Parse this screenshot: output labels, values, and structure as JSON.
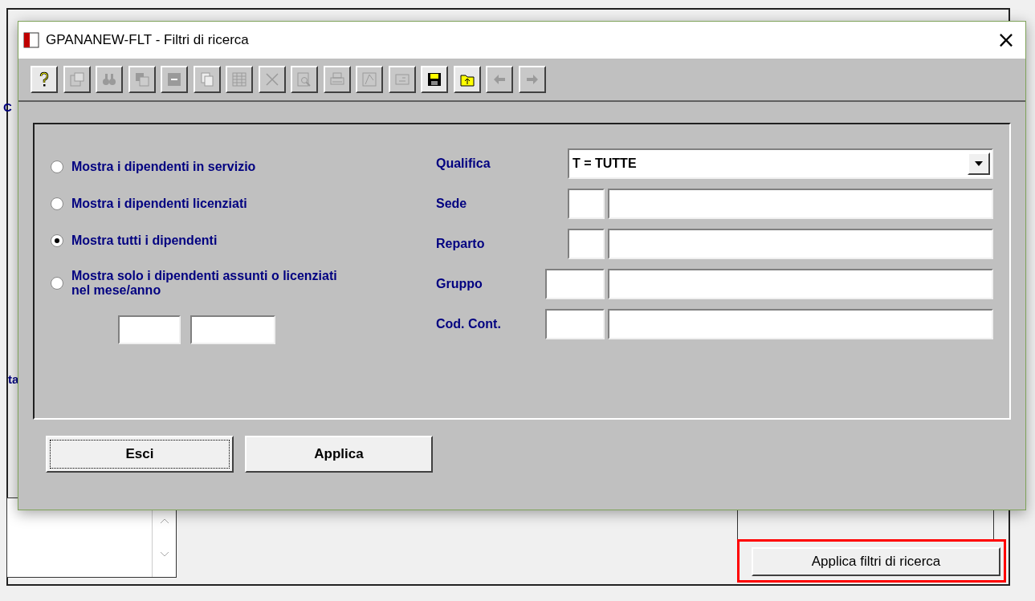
{
  "background": {
    "fragments": [
      "C",
      "ta"
    ],
    "apply_button": "Applica filtri di ricerca",
    "highlighted": true
  },
  "window": {
    "title": "GPANANEW-FLT - Filtri di ricerca",
    "close": "×"
  },
  "toolbar": [
    {
      "disabled": false
    },
    {
      "disabled": true
    },
    {
      "disabled": true
    },
    {
      "disabled": true
    },
    {
      "disabled": true
    },
    {
      "disabled": true
    },
    {
      "disabled": true
    },
    {
      "disabled": true
    },
    {
      "disabled": true
    },
    {
      "disabled": true
    },
    {
      "disabled": true
    },
    {
      "disabled": true
    },
    {
      "disabled": false
    },
    {
      "disabled": false
    },
    {
      "disabled": true
    },
    {
      "disabled": true
    }
  ],
  "options": [
    {
      "label": "Mostra i dipendenti in servizio",
      "selected": false
    },
    {
      "label": "Mostra i dipendenti licenziati",
      "selected": false
    },
    {
      "label": "Mostra tutti i dipendenti",
      "selected": true
    },
    {
      "label": "Mostra solo i dipendenti assunti o licenziati nel mese/anno",
      "selected": false
    }
  ],
  "filters": [
    {
      "kind": "dropdown",
      "label": "Qualifica",
      "value": "T = TUTTE"
    },
    {
      "kind": "code",
      "label": "Sede"
    },
    {
      "kind": "code",
      "label": "Reparto"
    },
    {
      "kind": "wide_code",
      "label": "Gruppo"
    },
    {
      "kind": "wide_code",
      "label": "Cod. Cont."
    }
  ],
  "buttons": [
    {
      "label": "Esci",
      "focused": true
    },
    {
      "label": "Applica",
      "focused": false
    }
  ]
}
